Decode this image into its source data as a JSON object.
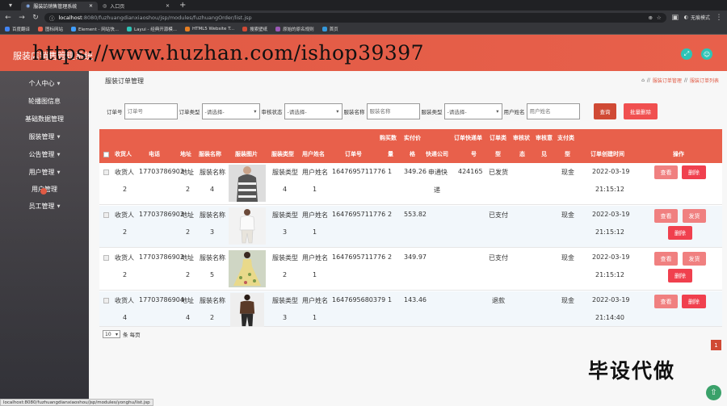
{
  "browser": {
    "tabs": [
      {
        "title": "服装訪销售管理系统",
        "active": true
      },
      {
        "title": "入口页",
        "active": false
      }
    ],
    "url_host": "localhost",
    "url_path": ":8080/fuzhuangdianxiaoshou/jsp/modules/fuzhuangOrder/list.jsp",
    "profile": "无痕模式",
    "bookmarks": [
      "百度翻译",
      "图标网站",
      "Element - 网站快...",
      "Layui - 经典开源模...",
      "HTML5 Website T...",
      "搜索壁纸",
      "原始的原名规则",
      "首页"
    ],
    "status_url": "localhost:8080/fuzhuangdianxiaoshou/jsp/modules/yonghu/list.jsp"
  },
  "header": {
    "title": "服装店销售管理系统",
    "watermark": "https://www.huzhan.com/ishop39397"
  },
  "sidebar": {
    "items": [
      {
        "label": "个人中心"
      },
      {
        "label": "轮播图信息"
      },
      {
        "label": "基础数据管理"
      },
      {
        "label": "服装管理"
      },
      {
        "label": "公告管理"
      },
      {
        "label": "用户管理"
      },
      {
        "label": "用户管理"
      },
      {
        "label": "员工管理"
      }
    ]
  },
  "main": {
    "title": "服装订单管理",
    "breadcrumb": [
      "服装订单管理",
      "服装订单列表"
    ]
  },
  "search": {
    "order_no_label": "订单号",
    "order_no_placeholder": "订单号",
    "order_type_label": "订单类型",
    "order_type_value": "-请选择-",
    "audit_label": "审核状态",
    "audit_value": "-请选择-",
    "name_label": "服装名称",
    "name_placeholder": "服装名称",
    "type_label": "服装类型",
    "type_value": "-请选择-",
    "user_label": "用户姓名",
    "user_placeholder": "用户姓名",
    "query_btn": "查询",
    "batch_delete_btn": "批量删除"
  },
  "table": {
    "headers": {
      "receiver": "收货人",
      "phone": "电话",
      "address": "地址",
      "cloth_name": "服装名称",
      "cloth_img": "服装图片",
      "cloth_type": "服装类型",
      "user_name": "用户姓名",
      "order_no": "订单号",
      "qty_a": "购买数",
      "qty_b": "量",
      "price_a": "实付价",
      "price_b": "格",
      "express": "快递公司",
      "express_no_a": "订单快递单",
      "express_no_b": "号",
      "order_type_a": "订单类",
      "order_type_b": "型",
      "audit_a": "审核状",
      "audit_b": "态",
      "audit_note_a": "审核意",
      "audit_note_b": "见",
      "pay_a": "支付类",
      "pay_b": "型",
      "created": "订单创建时间",
      "ops": "操作"
    },
    "rows": [
      {
        "receiver_a": "收货人",
        "receiver_b": "2",
        "phone": "17703786902",
        "addr_a": "地址",
        "addr_b": "2",
        "name_a": "服装名称",
        "name_b": "4",
        "type_a": "服装类型",
        "type_b": "4",
        "user_a": "用户姓名",
        "user_b": "1",
        "order_no": "1647695711776",
        "qty": "1",
        "price": "349.26",
        "express_a": "申通快",
        "express_b": "递",
        "express_no": "424165",
        "order_type": "已发货",
        "pay": "现金",
        "date": "2022-03-19",
        "time": "21:15:12",
        "btn_view": "查看",
        "btn_del": "删除"
      },
      {
        "receiver_a": "收货人",
        "receiver_b": "2",
        "phone": "17703786902",
        "addr_a": "地址",
        "addr_b": "2",
        "name_a": "服装名称",
        "name_b": "3",
        "type_a": "服装类型",
        "type_b": "3",
        "user_a": "用户姓名",
        "user_b": "1",
        "order_no": "1647695711776",
        "qty": "2",
        "price": "553.82",
        "order_type": "已支付",
        "pay": "现金",
        "date": "2022-03-19",
        "time": "21:15:12",
        "btn_view": "查看",
        "btn_ship": "发货",
        "btn_del": "删除"
      },
      {
        "receiver_a": "收货人",
        "receiver_b": "2",
        "phone": "17703786902",
        "addr_a": "地址",
        "addr_b": "2",
        "name_a": "服装名称",
        "name_b": "5",
        "type_a": "服装类型",
        "type_b": "2",
        "user_a": "用户姓名",
        "user_b": "1",
        "order_no": "1647695711776",
        "qty": "2",
        "price": "349.97",
        "order_type": "已支付",
        "pay": "现金",
        "date": "2022-03-19",
        "time": "21:15:12",
        "btn_view": "查看",
        "btn_ship": "发货",
        "btn_del": "删除"
      },
      {
        "receiver_a": "收货人",
        "receiver_b": "4",
        "phone": "17703786904",
        "addr_a": "地址",
        "addr_b": "4",
        "name_a": "服装名称",
        "name_b": "2",
        "type_a": "服装类型",
        "type_b": "3",
        "user_a": "用户姓名",
        "user_b": "1",
        "order_no": "1647695680379",
        "qty": "1",
        "price": "143.46",
        "order_type": "退款",
        "pay": "现金",
        "date": "2022-03-19",
        "time": "21:14:40",
        "btn_view": "查看",
        "btn_del": "删除"
      }
    ]
  },
  "pager": {
    "page_size": "10",
    "suffix": "条 每页",
    "current": "1"
  },
  "overlay": "毕设代做",
  "colors": {
    "accent": "#e8604b",
    "delete": "#f0404e",
    "view": "#f08080"
  }
}
